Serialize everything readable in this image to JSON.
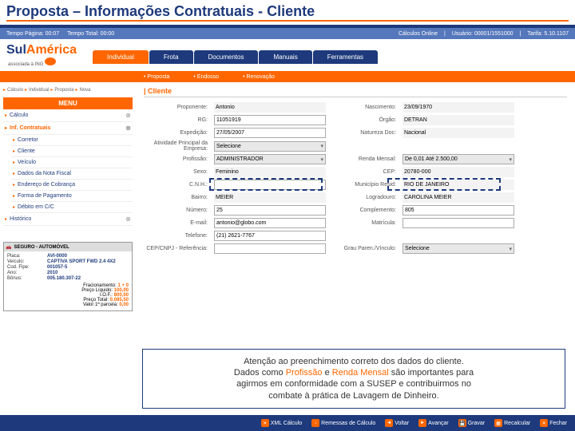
{
  "title": "Proposta – Informações Contratuais - Cliente",
  "header": {
    "tempo_pagina": "Tempo Página: 00:07",
    "tempo_total": "Tempo Total: 00:00",
    "calculos": "Cálculos Online",
    "usuario": "Usuário: 00001/1551000",
    "tarifa": "Tarifa: 5.10.1107"
  },
  "logo": {
    "sul": "Sul",
    "america": "América",
    "sub": "associada à ING"
  },
  "tabs": {
    "main": [
      "Individual",
      "Frota",
      "Documentos",
      "Manuais",
      "Ferramentas"
    ],
    "sub": [
      "• Proposta",
      "• Endosso",
      "• Renovação"
    ]
  },
  "breadcrumb": [
    "Cálculo",
    "Individual",
    "Proposta",
    "Nova"
  ],
  "menu": {
    "header": "MENU",
    "items": [
      {
        "label": "Cálculo",
        "active": false,
        "collapse": true
      },
      {
        "label": "Inf. Contratuais",
        "active": true,
        "collapse": true
      },
      {
        "label": "Corretor",
        "sub": true
      },
      {
        "label": "Cliente",
        "sub": true
      },
      {
        "label": "Veículo",
        "sub": true
      },
      {
        "label": "Dados da Nota Fiscal",
        "sub": true
      },
      {
        "label": "Endereço de Cobrança",
        "sub": true
      },
      {
        "label": "Forma de Pagamento",
        "sub": true
      },
      {
        "label": "Débito em C/C",
        "sub": true
      },
      {
        "label": "Histórico",
        "active": false,
        "collapse": true
      }
    ]
  },
  "vehicle": {
    "header": "SEGURO - AUTOMÓVEL",
    "placa_l": "Placa:",
    "placa": "AVI-0000",
    "veiculo_l": "Veículo:",
    "veiculo": "CAPTIVA SPORT FWD 2.4 4X2",
    "fipe_l": "Cod. Fipe:",
    "fipe": "001057-5",
    "ano_l": "Ano:",
    "ano": "2010",
    "bonus_l": "Bônus:",
    "bonus": "005.180.307-22",
    "frac_l": "Fracionamento:",
    "frac": "1 + 0",
    "liq_l": "Preço Líquido:",
    "liq": "100,00",
    "iof_l": "I.O.F.:",
    "iof": "800,00",
    "total_l": "Preço Total:",
    "total": "0.085,50",
    "parc_l": "Valor 1ª parcela:",
    "parc": "0,00"
  },
  "form": {
    "section": "| Cliente",
    "proponente_l": "Proponente:",
    "proponente": "Antonio",
    "nasc_l": "Nascimento:",
    "nasc": "23/09/1970",
    "rg_l": "RG:",
    "rg": "11051919",
    "orgao_l": "Órgão:",
    "orgao": "DETRAN",
    "exped_l": "Expedição:",
    "exped": "27/05/2007",
    "natdoc_l": "Natureza Doc:",
    "natdoc": "Nacional",
    "atividade_l": "Atividade Principal da Empresa:",
    "atividade": "Selecione",
    "profissao_l": "Profissão:",
    "profissao": "ADMINISTRADOR",
    "renda_l": "Renda Mensal:",
    "renda": "De 0,01 Até 2.500,00",
    "sexo_l": "Sexo:",
    "sexo": "Feminino",
    "cep_l": "CEP:",
    "cep": "20780-000",
    "cnh_l": "C.N.H.:",
    "cnh": "",
    "municipio_l": "Município Resid:",
    "municipio": "RIO DE JANEIRO",
    "bairro_l": "Bairro:",
    "bairro": "MEIER",
    "logradouro_l": "Logradouro:",
    "logradouro": "CAROLINA MEIER",
    "numero_l": "Número:",
    "numero": "25",
    "complemento_l": "Complemento:",
    "complemento": "805",
    "email_l": "E-mail:",
    "email": "antonio@globo.com",
    "matricula_l": "Matrícula:",
    "matricula": "",
    "telefone_l": "Telefone:",
    "telefone": "(21) 2621-7767",
    "refere_l": "CEP/CNPJ - Referência:",
    "refere": "",
    "grau_l": "Grau Paren./Vínculo:",
    "grau": "Selecione"
  },
  "attention": {
    "line1": "Atenção ao preenchimento correto dos dados do cliente.",
    "line2a": "Dados como ",
    "prof": "Profissão",
    "line2b": " e ",
    "renda": "Renda Mensal",
    "line2c": " são importantes para",
    "line3": "agirmos em conformidade com a SUSEP e contribuirmos no",
    "line4": "combate à prática de Lavagem de Dinheiro."
  },
  "bottom": {
    "xml": "XML Cálculo",
    "remessas": "Remessas de Cálculo",
    "voltar": "Voltar",
    "avancar": "Avançar",
    "gravar": "Gravar",
    "recalcular": "Recalcular",
    "fechar": "Fechar"
  }
}
